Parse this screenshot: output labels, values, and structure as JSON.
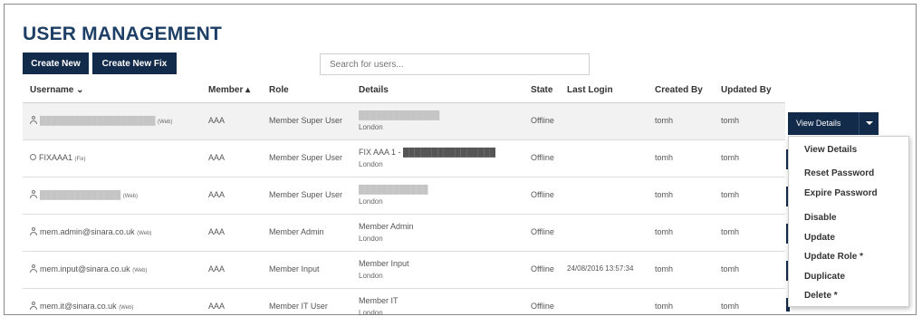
{
  "page": {
    "title": "USER MANAGEMENT"
  },
  "toolbar": {
    "create_new_label": "Create New",
    "create_new_fix_label": "Create New Fix"
  },
  "search": {
    "placeholder": "Search for users..."
  },
  "table": {
    "headers": {
      "username": "Username ⌄",
      "member": "Member ▴",
      "role": "Role",
      "details": "Details",
      "state": "State",
      "last_login": "Last Login",
      "created_by": "Created By",
      "updated_by": "Updated By"
    },
    "rows": [
      {
        "icon": "user-icon",
        "username": "████████████████████",
        "tag": "(Web)",
        "member": "AAA",
        "role": "Member Super User",
        "details": "██████████████",
        "location": "London",
        "state": "Offline",
        "last_login": "",
        "created_by": "tomh",
        "updated_by": "tomh"
      },
      {
        "icon": "circle-icon",
        "username": "FIXAAA1",
        "tag": "(Fix)",
        "member": "AAA",
        "role": "Member Super User",
        "details": "FIX AAA 1 - ████████████████",
        "location": "London",
        "state": "Offline",
        "last_login": "",
        "created_by": "tomh",
        "updated_by": "tomh"
      },
      {
        "icon": "user-icon",
        "username": "██████████████",
        "tag": "(Web)",
        "member": "AAA",
        "role": "Member Super User",
        "details": "████████████",
        "location": "London",
        "state": "Offline",
        "last_login": "",
        "created_by": "tomh",
        "updated_by": "tomh"
      },
      {
        "icon": "user-icon",
        "username": "mem.admin@sinara.co.uk",
        "tag": "(Web)",
        "member": "AAA",
        "role": "Member Admin",
        "details": "Member Admin",
        "location": "London",
        "state": "Offline",
        "last_login": "",
        "created_by": "tomh",
        "updated_by": "tomh"
      },
      {
        "icon": "user-icon",
        "username": "mem.input@sinara.co.uk",
        "tag": "(Web)",
        "member": "AAA",
        "role": "Member Input",
        "details": "Member Input",
        "location": "London",
        "state": "Offline",
        "last_login": "24/08/2016 13:57:34",
        "created_by": "tomh",
        "updated_by": "tomh"
      },
      {
        "icon": "user-icon",
        "username": "mem.it@sinara.co.uk",
        "tag": "(Web)",
        "member": "AAA",
        "role": "Member IT User",
        "details": "Member IT",
        "location": "London",
        "state": "Offline",
        "last_login": "",
        "created_by": "tomh",
        "updated_by": "tomh"
      }
    ]
  },
  "actions": {
    "view_details_label": "View Details",
    "menu": [
      {
        "label": "View Details"
      },
      {
        "label": "Reset Password"
      },
      {
        "label": "Expire Password"
      },
      {
        "label": "Disable"
      },
      {
        "label": "Update"
      },
      {
        "label": "Update Role *"
      },
      {
        "label": "Duplicate"
      },
      {
        "label": "Delete *"
      }
    ]
  },
  "colors": {
    "brand_navy": "#132b4a",
    "title_blue": "#1d3f66"
  }
}
